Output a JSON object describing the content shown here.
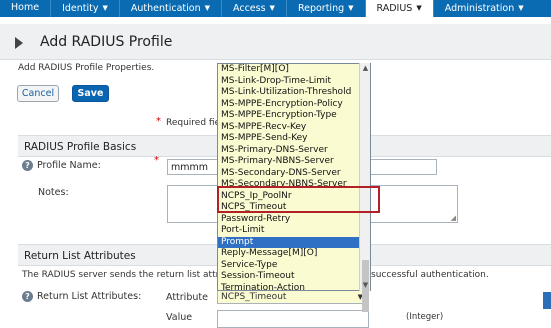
{
  "topnav": {
    "tabs": [
      {
        "label": "Home",
        "caret": false
      },
      {
        "label": "Identity",
        "caret": true
      },
      {
        "label": "Authentication",
        "caret": true
      },
      {
        "label": "Access",
        "caret": true
      },
      {
        "label": "Reporting",
        "caret": true
      },
      {
        "label": "RADIUS",
        "caret": true,
        "active": true
      },
      {
        "label": "Administration",
        "caret": true
      }
    ]
  },
  "page": {
    "title": "Add RADIUS Profile",
    "subtitle": "Add RADIUS Profile Properties.",
    "cancel_label": "Cancel",
    "save_label": "Save",
    "required_star": "*",
    "required_text": "Required fie"
  },
  "basics": {
    "header": "RADIUS Profile Basics",
    "profile_name_label": "Profile Name:",
    "profile_name_value": "mmmm",
    "notes_label": "Notes:",
    "help_glyph": "?"
  },
  "return_list": {
    "header": "Return List Attributes",
    "desc_left": "The RADIUS server sends the return list attri",
    "desc_right": "successful authentication.",
    "label": "Return List Attributes:",
    "attribute_label": "Attribute",
    "attribute_value": "NCPS_Timeout",
    "value_label": "Value",
    "integer_label": "(Integer)"
  },
  "dropdown": {
    "items": [
      "MS-Filter[M][O]",
      "MS-Link-Drop-Time-Limit",
      "MS-Link-Utilization-Threshold",
      "MS-MPPE-Encryption-Policy",
      "MS-MPPE-Encryption-Type",
      "MS-MPPE-Recv-Key",
      "MS-MPPE-Send-Key",
      "MS-Primary-DNS-Server",
      "MS-Primary-NBNS-Server",
      "MS-Secondary-DNS-Server",
      "MS-Secondary-NBNS-Server",
      "NCPS_Ip_PoolNr",
      "NCPS_Timeout",
      "Password-Retry",
      "Port-Limit",
      "Prompt",
      "Reply-Message[M][O]",
      "Service-Type",
      "Session-Timeout",
      "Termination-Action"
    ],
    "selected_index": 15,
    "highlighted": [
      "NCPS_Ip_PoolNr",
      "NCPS_Timeout"
    ]
  },
  "colors": {
    "nav_bg": "#0a6bb3",
    "save_bg": "#0a65b0",
    "dropdown_bg": "#fbfbd2",
    "selection": "#2f6fc4",
    "highlight_border": "#b42028"
  }
}
